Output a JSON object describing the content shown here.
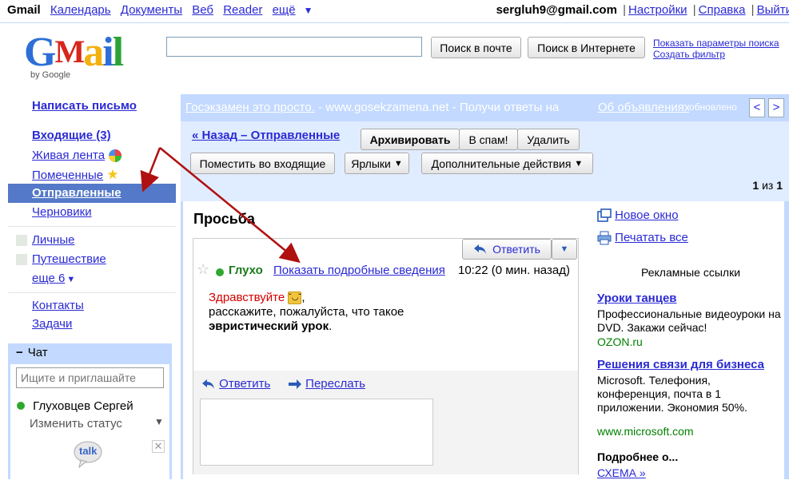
{
  "topbar": {
    "brand": "Gmail",
    "links": [
      "Календарь",
      "Документы",
      "Веб",
      "Reader",
      "ещё"
    ],
    "email": "sergluh9@gmail.com",
    "right_links": [
      "Настройки",
      "Справка",
      "Выйти"
    ]
  },
  "logo": {
    "byline": "by Google"
  },
  "search": {
    "value": "",
    "mail_button": "Поиск в почте",
    "web_button": "Поиск в Интернете",
    "show_options": "Показать параметры поиска",
    "create_filter": "Создать фильтр"
  },
  "nav": {
    "compose": "Написать письмо",
    "inbox": "Входящие (3)",
    "buzz": "Живая лента",
    "starred": "Помеченные",
    "sent": "Отправленные",
    "drafts": "Черновики",
    "labels": [
      "Личные",
      "Путешествие"
    ],
    "more": "еще 6",
    "contacts": "Контакты",
    "tasks": "Задачи"
  },
  "chat": {
    "title": "Чат",
    "search_placeholder": "Ищите и приглашайте",
    "user": "Глуховцев Сергей",
    "status": "Изменить статус",
    "talk_logo": "talk"
  },
  "adbar": {
    "link": "Госэкзамен это просто.",
    "text": " - www.gosekzamena.net - Получи ответы на",
    "about": "Об объявлениях",
    "time": "обновлено"
  },
  "toolbar": {
    "back": "« Назад – Отправленные",
    "archive": "Архивировать",
    "spam": "В спам!",
    "delete": "Удалить",
    "move_inbox": "Поместить во входящие",
    "labels": "Ярлыки",
    "more_actions": "Дополнительные действия",
    "counter_pos": "1",
    "counter_of": "из",
    "counter_total": "1"
  },
  "message": {
    "subject": "Просьба",
    "reply_button": "Ответить",
    "sender": "Глухо",
    "show_details": "Показать подробные сведения",
    "time": "10:22 (0 мин. назад)",
    "greeting": "Здравствуйте",
    "comma": ",",
    "line2": "расскажите, пожалуйста, что такое",
    "line3_bold": "эвристический урок",
    "line3_end": ".",
    "reply_link": "Ответить",
    "forward_link": "Переслать"
  },
  "right": {
    "new_window": "Новое окно",
    "print_all": "Печатать все",
    "sponsored": "Рекламные ссылки",
    "ads": [
      {
        "title": "Уроки танцев",
        "text": "Профессиональные видеоуроки на DVD. Закажи сейчас!",
        "url": "OZON.ru"
      },
      {
        "title": "Решения связи для бизнеса",
        "text": "Microsoft. Телефония, конференция, почта в 1 приложении. Экономия 50%.",
        "url": "www.microsoft.com"
      }
    ],
    "more_title": "Подробнее о...",
    "more_link": "СХЕМА »"
  },
  "colors": {
    "nav_selected": "#5479c8",
    "panel": "#c3d9ff",
    "toolbar": "#e0ecff",
    "link": "#2a2ad5",
    "arrow": "#b01010"
  }
}
